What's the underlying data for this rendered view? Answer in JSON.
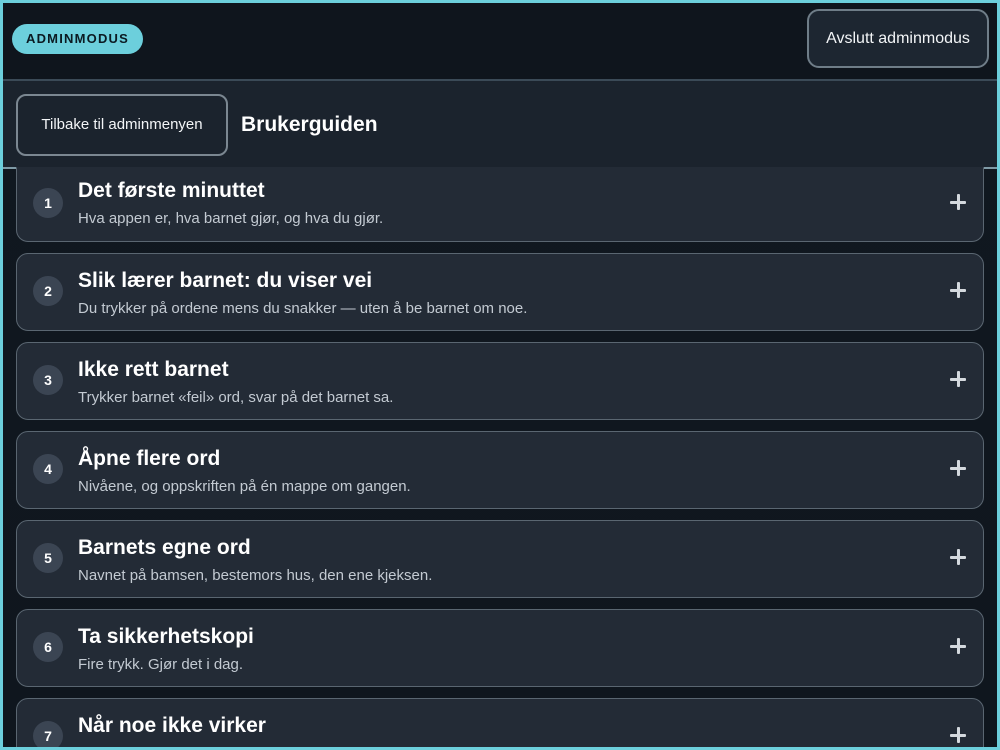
{
  "topbar": {
    "badge": "ADMINMODUS",
    "exit_button": "Avslutt adminmodus"
  },
  "subbar": {
    "back_button": "Tilbake til adminmenyen",
    "title": "Brukerguiden"
  },
  "guide": {
    "items": [
      {
        "num": "1",
        "title": "Det første minuttet",
        "desc": "Hva appen er, hva barnet gjør, og hva du gjør.",
        "icon": "plus-icon"
      },
      {
        "num": "2",
        "title": "Slik lærer barnet: du viser vei",
        "desc": "Du trykker på ordene mens du snakker — uten å be barnet om noe.",
        "icon": "plus-icon"
      },
      {
        "num": "3",
        "title": "Ikke rett barnet",
        "desc": "Trykker barnet «feil» ord, svar på det barnet sa.",
        "icon": "plus-icon"
      },
      {
        "num": "4",
        "title": "Åpne flere ord",
        "desc": "Nivåene, og oppskriften på én mappe om gangen.",
        "icon": "plus-icon"
      },
      {
        "num": "5",
        "title": "Barnets egne ord",
        "desc": "Navnet på bamsen, bestemors hus, den ene kjeksen.",
        "icon": "plus-icon"
      },
      {
        "num": "6",
        "title": "Ta sikkerhetskopi",
        "desc": "Fire trykk. Gjør det i dag.",
        "icon": "plus-icon"
      },
      {
        "num": "7",
        "title": "Når noe ikke virker",
        "desc": "",
        "icon": "plus-icon"
      }
    ]
  },
  "colors": {
    "accent": "#6ccfdc",
    "card_bg": "#232b36",
    "page_bg": "#0f151d"
  }
}
